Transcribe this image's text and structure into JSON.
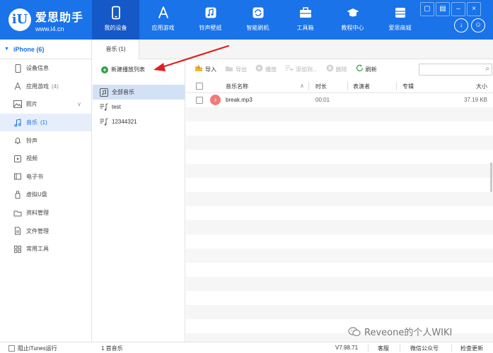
{
  "app": {
    "brand_name": "爱思助手",
    "brand_url": "www.i4.cn",
    "logo_text": "iU"
  },
  "nav": {
    "items": [
      {
        "label": "我的设备",
        "icon": "phone-icon",
        "active": true
      },
      {
        "label": "应用游戏",
        "icon": "app-store-icon"
      },
      {
        "label": "铃声壁纸",
        "icon": "music-icon"
      },
      {
        "label": "智能刷机",
        "icon": "refresh-icon"
      },
      {
        "label": "工具箱",
        "icon": "toolbox-icon"
      },
      {
        "label": "教程中心",
        "icon": "graduation-cap-icon"
      },
      {
        "label": "爱思商城",
        "icon": "store-icon"
      }
    ]
  },
  "device": {
    "name": "iPhone (6)"
  },
  "sidebar": {
    "items": [
      {
        "label": "设备信息",
        "icon": "device-info-icon"
      },
      {
        "label": "应用游戏",
        "count": "(4)",
        "icon": "apps-icon"
      },
      {
        "label": "照片",
        "icon": "photo-icon"
      },
      {
        "label": "音乐",
        "count": "(1)",
        "icon": "music-note-icon",
        "active": true
      },
      {
        "label": "铃声",
        "icon": "bell-icon"
      },
      {
        "label": "视频",
        "icon": "video-icon"
      },
      {
        "label": "电子书",
        "icon": "ebook-icon"
      },
      {
        "label": "虚拟U盘",
        "icon": "usb-icon"
      },
      {
        "label": "资料管理",
        "icon": "folder-icon"
      },
      {
        "label": "文件管理",
        "icon": "file-icon"
      },
      {
        "label": "常用工具",
        "icon": "grid-icon"
      }
    ]
  },
  "tab": {
    "label": "音乐 (1)"
  },
  "playlists": {
    "new_label": "新建播放列表",
    "items": [
      {
        "label": "全部音乐",
        "active": true
      },
      {
        "label": "test"
      },
      {
        "label": "12344321"
      }
    ]
  },
  "toolbar": {
    "import": "导入",
    "export": "导出",
    "play": "播放",
    "add_to": "添加到...",
    "delete": "删除",
    "refresh": "刷新",
    "search_placeholder": ""
  },
  "table": {
    "headers": {
      "name": "音乐名称",
      "duration": "时长",
      "artist": "表演者",
      "album": "专辑",
      "size": "大小"
    },
    "rows": [
      {
        "name": "break.mp3",
        "duration": "00:01",
        "artist": "",
        "album": "",
        "size": "37.19 KB"
      }
    ]
  },
  "watermark": {
    "text": "Reveone的个人WIKI"
  },
  "statusbar": {
    "itunes": "阻止iTunes运行",
    "count": "1 首音乐",
    "version": "V7.98.71",
    "customer_service": "客服",
    "wechat": "微信公众号",
    "update": "检查更新"
  },
  "colors": {
    "accent": "#1a73e8",
    "arrow": "#e02020"
  }
}
